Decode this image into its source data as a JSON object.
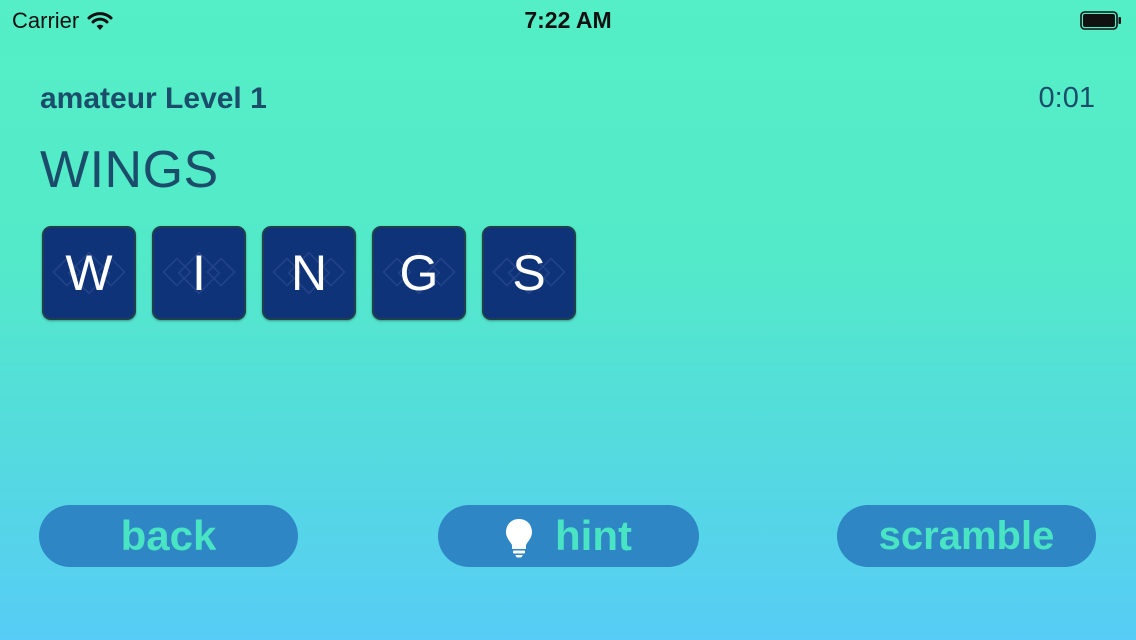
{
  "status_bar": {
    "carrier": "Carrier",
    "time": "7:22 AM",
    "icons": [
      "wifi-icon",
      "battery-icon"
    ]
  },
  "game": {
    "level_title": "amateur Level 1",
    "timer": "0:01",
    "target_word": "WINGS",
    "tiles": [
      "W",
      "I",
      "N",
      "G",
      "S"
    ]
  },
  "buttons": {
    "back": "back",
    "hint": "hint",
    "scramble": "scramble"
  },
  "colors": {
    "background_top": "#54efc6",
    "background_bottom": "#56ccf6",
    "tile_fill": "#0f3378",
    "button_fill": "#2e86c4",
    "button_text": "#49e4c4",
    "heading_text": "#1b4d6b"
  }
}
